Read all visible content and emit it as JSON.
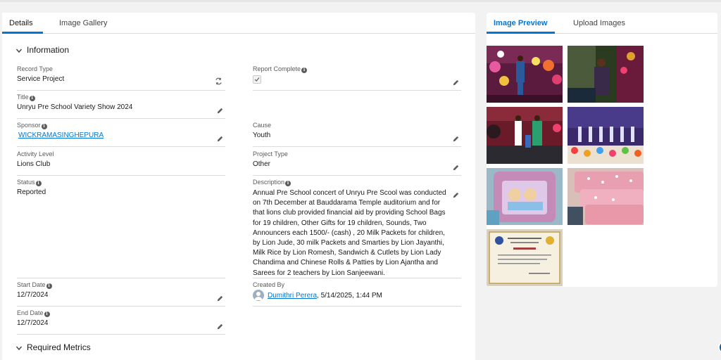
{
  "left_tabs": [
    "Details",
    "Image Gallery"
  ],
  "right_tabs": [
    "Image Preview",
    "Upload Images"
  ],
  "sections": {
    "information": "Information",
    "required_metrics": "Required Metrics"
  },
  "fields": {
    "record_type": {
      "label": "Record Type",
      "value": "Service Project"
    },
    "report_complete": {
      "label": "Report Complete",
      "checked": true
    },
    "title": {
      "label": "Title",
      "value": "Unryu Pre School Variety Show 2024"
    },
    "sponsor": {
      "label": "Sponsor",
      "value": "WICKRAMASINGHEPURA"
    },
    "cause": {
      "label": "Cause",
      "value": "Youth"
    },
    "activity_level": {
      "label": "Activity Level",
      "value": "Lions Club"
    },
    "project_type": {
      "label": "Project Type",
      "value": "Other"
    },
    "status": {
      "label": "Status",
      "value": "Reported"
    },
    "description": {
      "label": "Description",
      "value": "Annual Pre School concert of Unryu Pre Scool was conducted on 7th December at Bauddarama Temple auditorium and for that lions club provided financial aid by providing School Bags for 19 children, Other Gifts for 19 children, Sounds, Two Announcers each 1500/- (cash) , 20 Milk Packets for children, by Lion Jude, 30 milk Packets and Smarties by Lion Jayanthi, Milk Rice by Lion Romesh, Sandwich & Cutlets by Lion Lady Chandima and Chinese Rolls & Patties by Lion Ajantha and Sarees for 2 teachers by Lion Sanjeewani."
    },
    "start_date": {
      "label": "Start Date",
      "value": "12/7/2024"
    },
    "created_by": {
      "label": "Created By",
      "user": "Dumithri Perera",
      "timestamp": ", 5/14/2025, 1:44 PM"
    },
    "end_date": {
      "label": "End Date",
      "value": "12/7/2024"
    }
  },
  "icons": {
    "info": "info-icon",
    "edit": "pencil-icon",
    "record_type_change": "change-record-type-icon",
    "section_toggle": "chevron-down-icon",
    "user": "user-avatar-icon"
  },
  "colors": {
    "accent": "#0176d3",
    "link": "#0176d3",
    "page_background": "#f3f2f2",
    "border": "#dddbda"
  },
  "gallery": [
    {
      "name": "gallery-thumbnail-stage-performer",
      "bg": "#5a1b3e"
    },
    {
      "name": "gallery-thumbnail-woman-speaking",
      "bg": "#2a3b1f"
    },
    {
      "name": "gallery-thumbnail-stage-gift-giving",
      "bg": "#6b1a2a"
    },
    {
      "name": "gallery-thumbnail-children-dancing",
      "bg": "#3b2a6b"
    },
    {
      "name": "gallery-thumbnail-school-bag",
      "bg": "#c48ab8"
    },
    {
      "name": "gallery-thumbnail-pink-bags",
      "bg": "#e8a0b0"
    },
    {
      "name": "gallery-thumbnail-certificate",
      "bg": "#efe6cf"
    }
  ]
}
